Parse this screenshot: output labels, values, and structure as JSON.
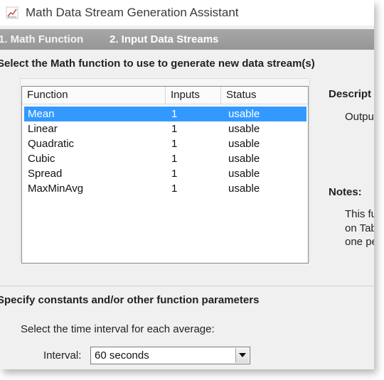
{
  "window": {
    "title": "Math Data Stream Generation Assistant",
    "icon": "chart-icon"
  },
  "tabs": [
    {
      "label": "1. Math Function",
      "active": true
    },
    {
      "label": "2. Input Data Streams",
      "active": false
    }
  ],
  "section1": {
    "heading": "Select the Math function to use to generate new data stream(s)"
  },
  "function_list": {
    "columns": [
      "Function",
      "Inputs",
      "Status"
    ],
    "rows": [
      {
        "function": "Mean",
        "inputs": "1",
        "status": "usable",
        "selected": true
      },
      {
        "function": "Linear",
        "inputs": "1",
        "status": "usable"
      },
      {
        "function": "Quadratic",
        "inputs": "1",
        "status": "usable"
      },
      {
        "function": "Cubic",
        "inputs": "1",
        "status": "usable"
      },
      {
        "function": "Spread",
        "inputs": "1",
        "status": "usable"
      },
      {
        "function": "MaxMinAvg",
        "inputs": "1",
        "status": "usable"
      }
    ]
  },
  "description": {
    "title": "Descript",
    "text": "Output"
  },
  "notes": {
    "title": "Notes:",
    "lines": [
      "This fu",
      "on Tab",
      "one pe"
    ]
  },
  "section2": {
    "heading": "Specify constants and/or other function parameters",
    "time_label": "Select the time interval for each average:",
    "interval_label": "Interval:",
    "interval_value": "60 seconds"
  },
  "colors": {
    "selection": "#3399ff",
    "tabbar": "#9d9d9d",
    "dialog_bg": "#f0f0f0"
  }
}
